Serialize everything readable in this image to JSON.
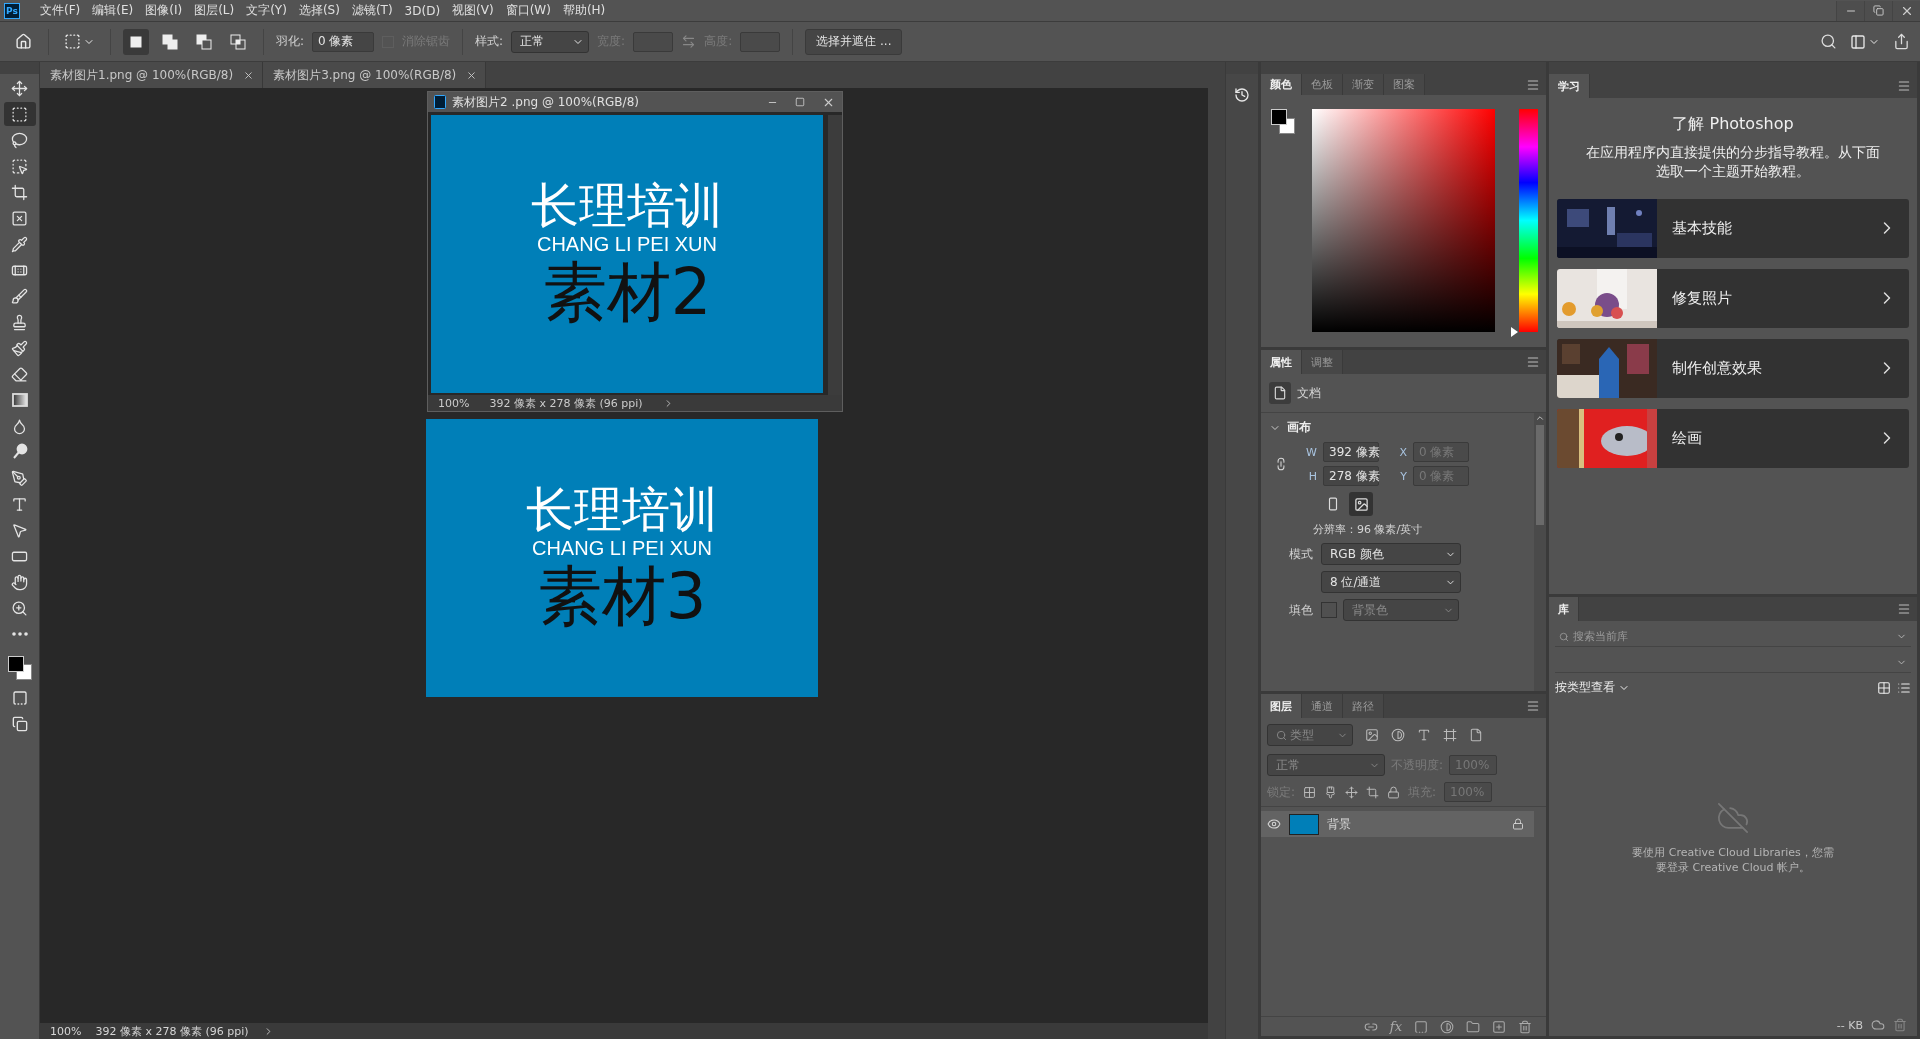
{
  "menu_bar": {
    "logo": "Ps",
    "items": [
      "文件(F)",
      "编辑(E)",
      "图像(I)",
      "图层(L)",
      "文字(Y)",
      "选择(S)",
      "滤镜(T)",
      "3D(D)",
      "视图(V)",
      "窗口(W)",
      "帮助(H)"
    ]
  },
  "options_bar": {
    "selection_modes": [
      {
        "kind": "new",
        "selected": true
      },
      {
        "kind": "add",
        "selected": false
      },
      {
        "kind": "subtract",
        "selected": false
      },
      {
        "kind": "intersect",
        "selected": false
      }
    ],
    "feather_label": "羽化:",
    "feather_value": "0 像素",
    "anti_alias": {
      "label": "消除锯齿",
      "checked": false,
      "disabled": true
    },
    "style_label": "样式:",
    "style_value": "正常",
    "width_label": "宽度:",
    "height_label": "高度:",
    "select_mask_button": "选择并遮住 ..."
  },
  "document_tabs": [
    {
      "title": "素材图片1.png @ 100%(RGB/8)"
    },
    {
      "title": "素材图片3.png @ 100%(RGB/8)"
    }
  ],
  "tools": [
    {
      "kind": "move",
      "selected": false
    },
    {
      "kind": "marquee",
      "selected": true
    },
    {
      "kind": "lasso",
      "selected": false
    },
    {
      "kind": "object-select",
      "selected": false
    },
    {
      "kind": "crop",
      "selected": false
    },
    {
      "kind": "frame",
      "selected": false
    },
    {
      "kind": "eyedropper",
      "selected": false
    },
    {
      "kind": "healing",
      "selected": false
    },
    {
      "kind": "brush",
      "selected": false
    },
    {
      "kind": "stamp",
      "selected": false
    },
    {
      "kind": "history-brush",
      "selected": false
    },
    {
      "kind": "eraser",
      "selected": false
    },
    {
      "kind": "gradient",
      "selected": false
    },
    {
      "kind": "blur",
      "selected": false
    },
    {
      "kind": "dodge",
      "selected": false
    },
    {
      "kind": "pen",
      "selected": false
    },
    {
      "kind": "type",
      "selected": false
    },
    {
      "kind": "path-select",
      "selected": false
    },
    {
      "kind": "rectangle",
      "selected": false
    },
    {
      "kind": "hand",
      "selected": false
    },
    {
      "kind": "zoom",
      "selected": false
    },
    {
      "kind": "more",
      "selected": false
    }
  ],
  "floating_window": {
    "title": "素材图片2 .png @ 100%(RGB/8)",
    "image": {
      "title": "长理培训",
      "subtitle": "CHANG LI PEI XUN",
      "label": "素材2"
    },
    "zoom": "100%",
    "info": "392 像素 x 278 像素 (96 ppi)"
  },
  "canvas_image": {
    "title": "长理培训",
    "subtitle": "CHANG LI PEI XUN",
    "label": "素材3"
  },
  "status_bar": {
    "zoom": "100%",
    "info": "392 像素 x 278 像素 (96 ppi)"
  },
  "color_panel": {
    "hue": {
      "level": 0
    },
    "tabs": [
      {
        "label": "颜色",
        "selected": true
      },
      {
        "label": "色板",
        "selected": false
      },
      {
        "label": "渐变",
        "selected": false
      },
      {
        "label": "图案",
        "selected": false
      }
    ]
  },
  "properties_panel": {
    "tabs": [
      {
        "label": "属性",
        "selected": true
      },
      {
        "label": "调整",
        "selected": false
      }
    ],
    "section_title": "文档",
    "canvas_header": "画布",
    "expanded": true,
    "width_label": "W",
    "width": "392 像素",
    "x_label": "X",
    "x": "0 像素",
    "height_label": "H",
    "height": "278 像素",
    "y_label": "Y",
    "y": "0 像素",
    "orientations": [
      {
        "kind": "portrait",
        "selected": false
      },
      {
        "kind": "landscape",
        "selected": true
      }
    ],
    "resolution": "分辨率：96 像素/英寸",
    "mode_label": "模式",
    "mode": "RGB 颜色",
    "depth": "8 位/通道",
    "fill_label": "填色",
    "fill": "背景色"
  },
  "layers_panel": {
    "tabs": [
      {
        "label": "图层",
        "selected": true
      },
      {
        "label": "通道",
        "selected": false
      },
      {
        "label": "路径",
        "selected": false
      }
    ],
    "filter_placeholder": "类型",
    "blend_mode": "正常",
    "opacity_label": "不透明度:",
    "opacity": "100%",
    "lock_label": "锁定:",
    "fill_label": "填充:",
    "fill": "100%",
    "layers": [
      {
        "name": "背景",
        "visible": true,
        "selected": true,
        "locked": true
      }
    ],
    "fx_label": "fx"
  },
  "learn_panel": {
    "tabs": [
      {
        "label": "学习",
        "selected": true
      }
    ],
    "title": "了解 Photoshop",
    "description": "在应用程序内直接提供的分步指导教程。从下面选取一个主题开始教程。",
    "topics": [
      {
        "label": "基本技能",
        "kind": "picture"
      },
      {
        "label": "修复照片",
        "kind": "picture"
      },
      {
        "label": "制作创意效果",
        "kind": "picture"
      },
      {
        "label": "绘画",
        "kind": "picture"
      }
    ]
  },
  "library_panel": {
    "tabs": [
      {
        "label": "库",
        "selected": true
      }
    ],
    "search_placeholder": "搜索当前库",
    "view_label": "按类型查看",
    "message": "要使用 Creative Cloud Libraries，您需要登录 Creative Cloud 帐户。",
    "size": "-- KB"
  }
}
